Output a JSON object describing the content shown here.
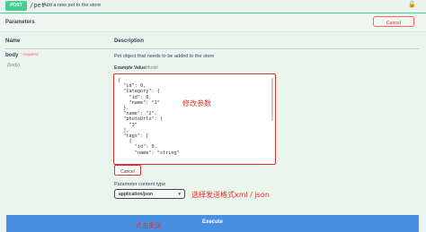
{
  "summary": {
    "method": "POST",
    "path": "/pet",
    "description": "Add a new pet to the store"
  },
  "parameters": {
    "title": "Parameters",
    "cancel_label": "Cancel",
    "col_name": "Name",
    "col_description": "Description"
  },
  "param": {
    "name": "body",
    "required": "* required",
    "location": "(body)",
    "description": "Pet object that needs to be added to the store",
    "example_label": "Example Value",
    "model_label": "Model",
    "example_value": "{\n  \"id\": 0,\n  \"category\": {\n    \"id\": 0,\n    \"name\": \"1\"\n  },\n  \"name\": \"2\",\n  \"photoUrls\": [\n    \"3\"\n  ],\n  \"tags\": [\n    {\n      \"id\": 0,\n      \"name\": \"string\""
  },
  "body_cancel_label": "Cancel",
  "content_type": {
    "label": "Parameter content type",
    "selected": "application/json"
  },
  "execute_label": "Execute",
  "annotations": {
    "edit_params": "修改参数",
    "select_format": "选择发送格式xml / json",
    "click_send": "点击发送"
  },
  "colors": {
    "post": "#49cc90",
    "annotation": "#e0302a",
    "execute": "#4990e2"
  }
}
